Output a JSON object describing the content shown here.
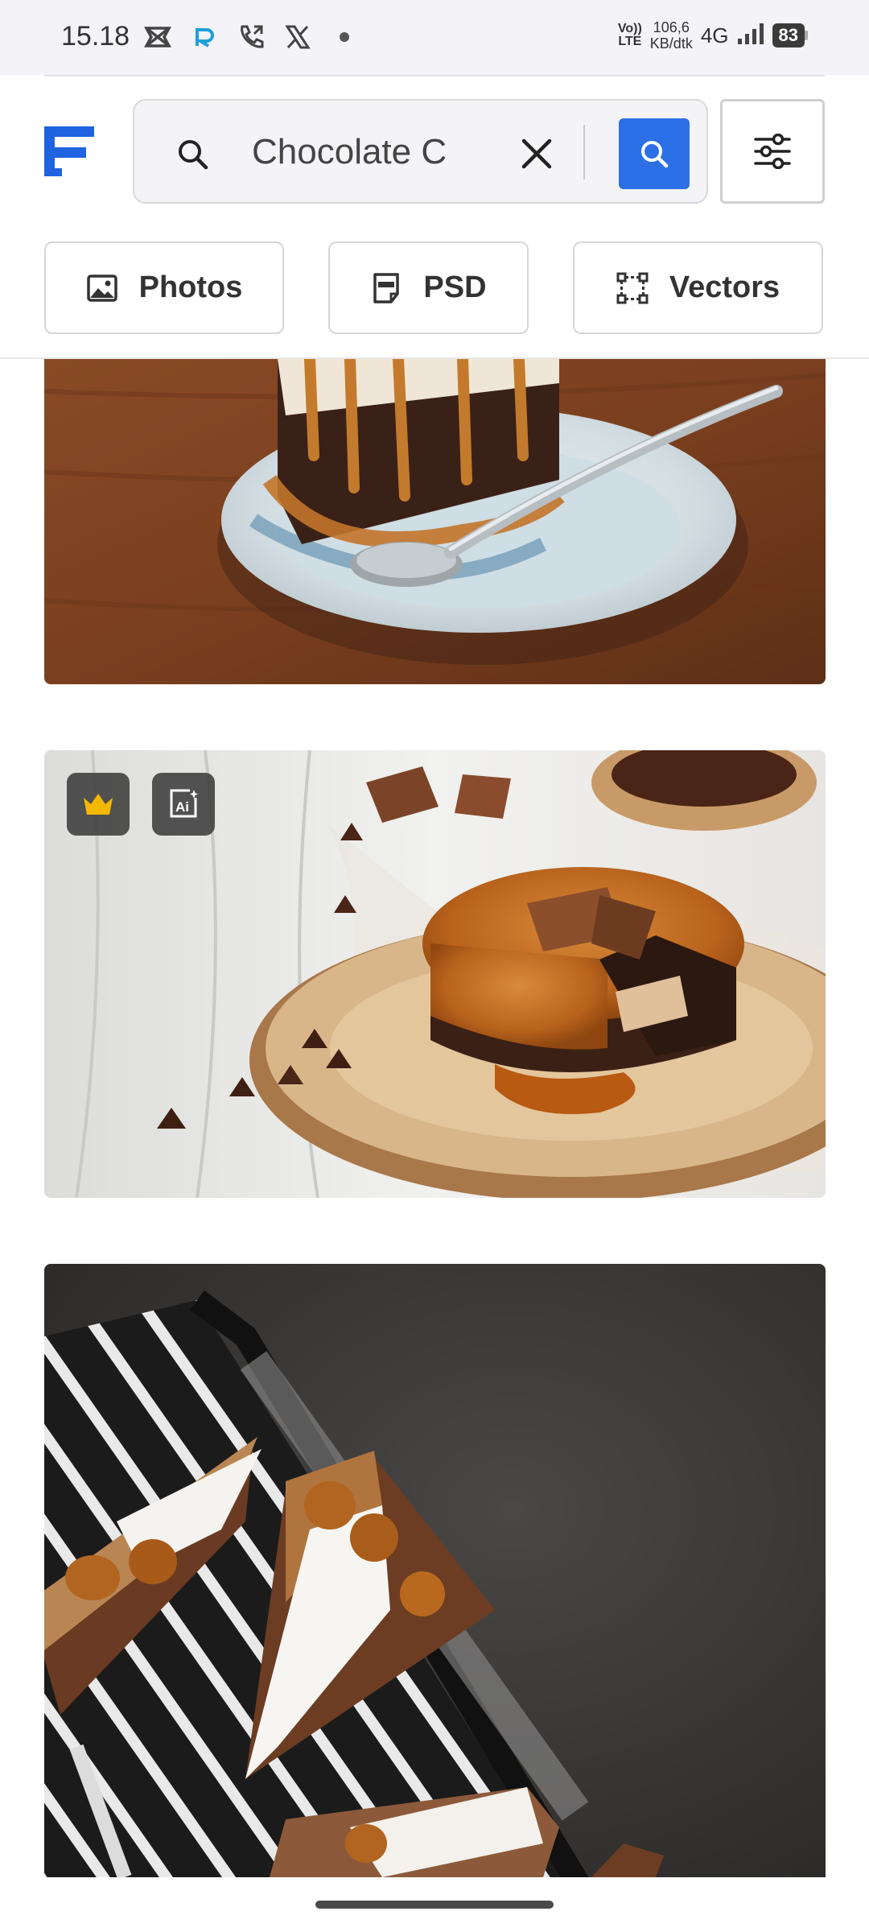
{
  "status_bar": {
    "time": "15.18",
    "volte_top": "Vo))",
    "volte_bottom": "LTE",
    "speed_value": "106,6",
    "speed_unit": "KB/dtk",
    "network": "4G",
    "battery": "83",
    "icons": [
      "capcut-icon",
      "app-r-icon",
      "phone-call-icon",
      "x-icon",
      "dot-icon",
      "signal-icon",
      "battery-icon"
    ]
  },
  "header": {
    "logo": "freepik-logo",
    "search": {
      "value": "Chocolate C",
      "search_icon": "search-icon",
      "clear_icon": "close-icon",
      "submit_icon": "search-icon"
    },
    "filter_icon": "sliders-icon",
    "tabs": [
      {
        "label": "Photos",
        "icon": "image-icon"
      },
      {
        "label": "PSD",
        "icon": "psd-file-icon"
      },
      {
        "label": "Vectors",
        "icon": "vector-icon"
      }
    ]
  },
  "results": [
    {
      "subject": "slice of chocolate cake with caramel drizzle and spoon on plate"
    },
    {
      "subject": "caramel-glazed chocolate cake on wooden board with chocolate pieces",
      "badges": [
        "crown-icon",
        "ai-icon"
      ]
    },
    {
      "subject": "caramel chocolate tart slices with cream on striped napkin"
    }
  ],
  "colors": {
    "accent": "#2c6fe6",
    "logo_blue": "#1f63e0",
    "premium_gold": "#f5b800",
    "status_bar_bg": "#f4f3f8"
  }
}
